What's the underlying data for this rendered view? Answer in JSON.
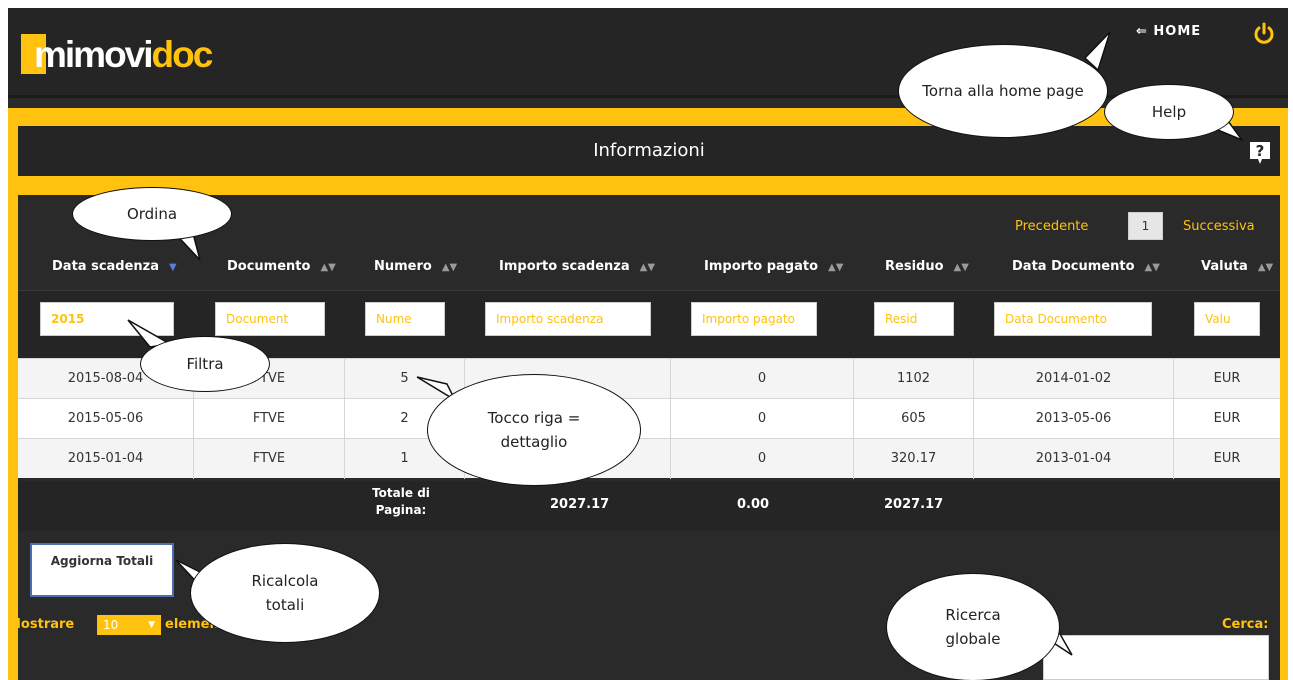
{
  "brand": {
    "logo_white": "mimovi",
    "logo_yellow": "doc"
  },
  "header": {
    "home_label": "⇐ HOME"
  },
  "section": {
    "title": "Informazioni"
  },
  "pager": {
    "prev": "Precedente",
    "page": "1",
    "next": "Successiva"
  },
  "columns": [
    {
      "label": "Data scadenza"
    },
    {
      "label": "Documento"
    },
    {
      "label": "Numero"
    },
    {
      "label": "Importo scadenza"
    },
    {
      "label": "Importo pagato"
    },
    {
      "label": "Residuo"
    },
    {
      "label": "Data Documento"
    },
    {
      "label": "Valuta"
    }
  ],
  "filters": [
    {
      "value": "2015"
    },
    {
      "value": "Document"
    },
    {
      "value": "Nume"
    },
    {
      "value": "Importo scadenza"
    },
    {
      "value": "Importo pagato"
    },
    {
      "value": "Resid"
    },
    {
      "value": "Data Documento"
    },
    {
      "value": "Valu"
    }
  ],
  "rows": [
    [
      "2015-08-04",
      "FTVE",
      "5",
      "",
      "0",
      "1102",
      "2014-01-02",
      "EUR"
    ],
    [
      "2015-05-06",
      "FTVE",
      "2",
      "",
      "0",
      "605",
      "2013-05-06",
      "EUR"
    ],
    [
      "2015-01-04",
      "FTVE",
      "1",
      "",
      "0",
      "320.17",
      "2013-01-04",
      "EUR"
    ]
  ],
  "totals": {
    "label": "Totale di Pagina:",
    "importo_scadenza": "2027.17",
    "importo_pagato": "0.00",
    "residuo": "2027.17"
  },
  "controls": {
    "refresh_button": "Aggiorna Totali",
    "show_prefix": "Mostrare",
    "show_value": "10",
    "show_suffix": "elementi",
    "search_label": "Cerca:"
  },
  "callouts": {
    "home": "Torna alla home page",
    "help": "Help",
    "sort": "Ordina",
    "filter": "Filtra",
    "row": "Tocco riga = dettaglio",
    "totals": "Ricalcola totali",
    "search": "Ricerca globale"
  },
  "colors": {
    "accent": "#ffc20e",
    "dark": "#252525",
    "sort_active": "#5b7fd8"
  },
  "icons": {
    "power": "power-icon",
    "help": "help-icon",
    "sort": "sort-icon"
  }
}
